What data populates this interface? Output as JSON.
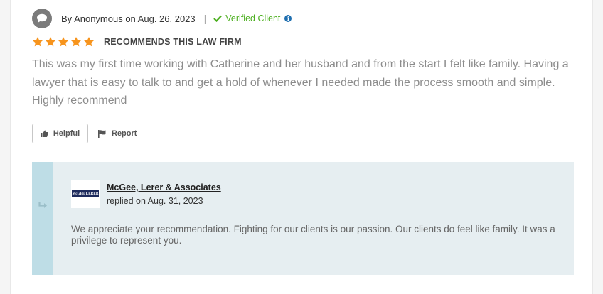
{
  "review": {
    "author_line": "By Anonymous on Aug. 26, 2023",
    "separator": "|",
    "verified_label": "Verified Client",
    "info_glyph": "i",
    "rating_stars": 5,
    "rating_max": 5,
    "star_color": "#f7941d",
    "recommends_label": "RECOMMENDS THIS LAW FIRM",
    "body": "This was my first time working with Catherine and her husband and from the start I felt like family. Having a lawyer that is easy to talk to and get a hold of whenever I needed made the process smooth and simple. Highly recommend",
    "icons": {
      "author": "speech-bubble-icon",
      "verified": "check-icon",
      "info": "info-icon",
      "helpful": "thumbs-up-icon",
      "report": "flag-icon"
    }
  },
  "actions": {
    "helpful_label": "Helpful",
    "report_label": "Report"
  },
  "reply": {
    "firm_name": "McGee, Lerer & Associates",
    "replied_line": "replied on Aug. 31, 2023",
    "logo_text": "McGEE LERER",
    "body": "We appreciate your recommendation. Fighting for our clients is our passion. Our clients do feel like family. It was a privilege to represent you.",
    "icons": {
      "reply": "reply-arrow-icon"
    }
  },
  "colors": {
    "verified_green": "#4caf1f",
    "reply_background": "#e6eef1",
    "reply_strip": "#bedde6",
    "info_blue": "#1f6fb0"
  }
}
